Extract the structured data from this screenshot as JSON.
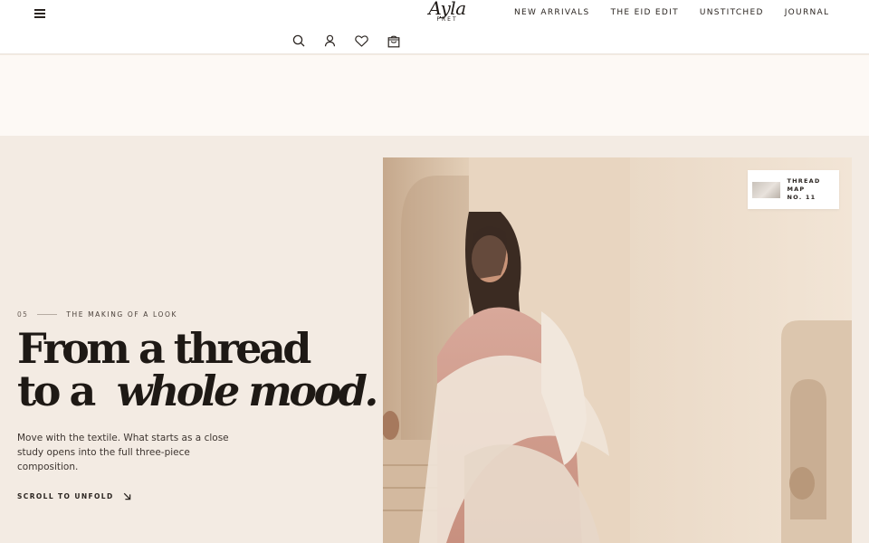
{
  "header": {
    "logo_main": "Ayla",
    "logo_sub": "PRET",
    "nav": [
      "NEW ARRIVALS",
      "THE EID EDIT",
      "UNSTITCHED",
      "JOURNAL"
    ],
    "icons": [
      "menu-icon",
      "search-icon",
      "account-icon",
      "wishlist-heart-icon",
      "shopping-bag-icon"
    ]
  },
  "editorial": {
    "number": "05",
    "kicker": "THE MAKING OF A LOOK",
    "headline_line1": "From a thread",
    "headline_line2_a": "to a",
    "headline_line2_b": "whole mood.",
    "body": "Move with the textile. What starts as a close study opens into the full three-piece composition.",
    "cta": "SCROLL TO UNFOLD"
  },
  "hero": {
    "card_title_1": "THREAD MAP",
    "card_title_2": "NO. 11"
  },
  "colors": {
    "page_bg": "#f3ebe3",
    "band_bg": "#fdf9f5",
    "text": "#1e1915"
  }
}
